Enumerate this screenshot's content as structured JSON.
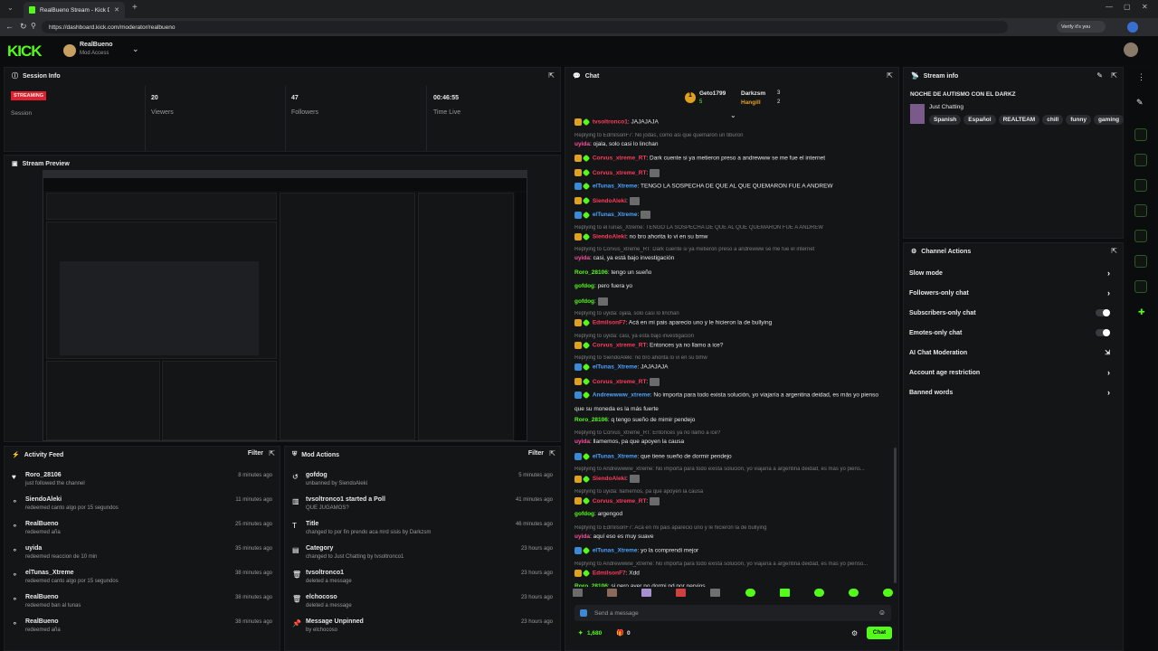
{
  "browser": {
    "tab_title": "RealBueno Stream - Kick Dashbo...",
    "url": "https://dashboard.kick.com/moderator/realbueno",
    "verify_label": "Verify it's you"
  },
  "header": {
    "logo": "KICK",
    "channel_name": "RealBueno",
    "channel_role": "Mod Access"
  },
  "session": {
    "title": "Session Info",
    "status": "STREAMING",
    "status_label": "Session",
    "viewers": "20",
    "viewers_label": "Viewers",
    "followers": "47",
    "followers_label": "Followers",
    "time": "00:46:55",
    "time_label": "Time Live"
  },
  "preview": {
    "title": "Stream Preview"
  },
  "activity": {
    "title": "Activity Feed",
    "filter": "Filter",
    "items": [
      {
        "name": "Roro_28106",
        "sub": "just followed the channel",
        "time": "8 minutes ago",
        "icon": "heart-icon"
      },
      {
        "name": "SiendoAleki",
        "sub": "redeemed canto algo por 15 segundos",
        "time": "11 minutes ago",
        "icon": "redeem-icon"
      },
      {
        "name": "RealBueno",
        "sub": "redeemed aña",
        "time": "25 minutes ago",
        "icon": "redeem-icon"
      },
      {
        "name": "uyida",
        "sub": "redeemed reaccion de 10 min",
        "time": "35 minutes ago",
        "icon": "redeem-icon"
      },
      {
        "name": "elTunas_Xtreme",
        "sub": "redeemed canto algo por 15 segundos",
        "time": "38 minutes ago",
        "icon": "redeem-icon"
      },
      {
        "name": "RealBueno",
        "sub": "redeemed ban al tunas",
        "time": "38 minutes ago",
        "icon": "redeem-icon"
      },
      {
        "name": "RealBueno",
        "sub": "redeemed aña",
        "time": "38 minutes ago",
        "icon": "redeem-icon"
      }
    ]
  },
  "modactions": {
    "title": "Mod Actions",
    "filter": "Filter",
    "items": [
      {
        "name": "gofdog",
        "sub": "unbanned by SiendoAleki",
        "time": "5 minutes ago",
        "icon": "undo-icon"
      },
      {
        "name": "tvsoltronco1 started a Poll",
        "sub": "QUE JUGAMOS?",
        "time": "41 minutes ago",
        "icon": "poll-icon"
      },
      {
        "name": "Title",
        "sub": "changed to por fin prendo aca mrd sisis by Darkzsm",
        "time": "46 minutes ago",
        "icon": "title-icon"
      },
      {
        "name": "Category",
        "sub": "changed to Just Chatting by tvsoltronco1",
        "time": "23 hours ago",
        "icon": "category-icon"
      },
      {
        "name": "tvsoltronco1",
        "sub": "deleted a message",
        "time": "23 hours ago",
        "icon": "trash-icon"
      },
      {
        "name": "elchocoso",
        "sub": "deleted a message",
        "time": "23 hours ago",
        "icon": "trash-icon"
      },
      {
        "name": "Message Unpinned",
        "sub": "by elchocoso",
        "time": "23 hours ago",
        "icon": "unpin-icon"
      }
    ]
  },
  "chat": {
    "title": "Chat",
    "top_gifters": [
      {
        "name": "Geto1799",
        "count": "5"
      },
      {
        "name": "Darkzsm",
        "count": "3"
      },
      {
        "name": "Hangill",
        "count": "2"
      }
    ],
    "messages": [
      {
        "reply": "",
        "user": "tvsoltronco1",
        "color": "red",
        "text": "JAJAJAJA"
      },
      {
        "reply": "Replying to EdmilsonF7: No jodas, como asi que quemaron un tiburon",
        "user": "uyida",
        "color": "pink",
        "text": "ojala, solo casi lo linchan"
      },
      {
        "reply": "",
        "user": "Corvus_xtreme_RT",
        "color": "red",
        "text": "Dark cuente si ya metieron preso a andrewww se me fue el internet"
      },
      {
        "reply": "",
        "user": "Corvus_xtreme_RT",
        "color": "red",
        "text": ""
      },
      {
        "reply": "",
        "user": "elTunas_Xtreme",
        "color": "blue",
        "text": "TENGO LA SOSPECHA DE QUE AL QUE QUEMARON FUE A ANDREW"
      },
      {
        "reply": "",
        "user": "SiendoAleki",
        "color": "red",
        "text": ""
      },
      {
        "reply": "",
        "user": "elTunas_Xtreme",
        "color": "blue",
        "text": ""
      },
      {
        "reply": "Replying to elTunas_Xtreme: TENGO LA SOSPECHA DE QUE AL QUE QUEMARON FUE A ANDREW",
        "user": "SiendoAleki",
        "color": "red",
        "text": "no bro ahorita lo vi en su bmw"
      },
      {
        "reply": "Replying to Corvus_xtreme_RT: Dark cuente si ya metieron preso a andrewww se me fue el internet",
        "user": "uyida",
        "color": "pink",
        "text": "casi, ya está bajo investigación"
      },
      {
        "reply": "",
        "user": "Roro_28106",
        "color": "green",
        "text": "tengo un sueño"
      },
      {
        "reply": "",
        "user": "gofdog",
        "color": "green",
        "text": "pero fuera yo"
      },
      {
        "reply": "",
        "user": "gofdog",
        "color": "green",
        "text": ""
      },
      {
        "reply": "Replying to uyida: ojalá, solo casi lo linchan",
        "user": "EdmilsonF7",
        "color": "red",
        "text": "Acá en mi pais aparecio uno y le hicieron la de bullying"
      },
      {
        "reply": "Replying to uyida: casi, ya está bajo investigación",
        "user": "Corvus_xtreme_RT",
        "color": "red",
        "text": "Entonces ya no llamo a ice?"
      },
      {
        "reply": "Replying to SiendoAleki: no bro ahorita lo vi en su bmw",
        "user": "elTunas_Xtreme",
        "color": "blue",
        "text": "JAJAJAJA"
      },
      {
        "reply": "",
        "user": "Corvus_xtreme_RT",
        "color": "red",
        "text": ""
      },
      {
        "reply": "",
        "user": "Andrewwww_xtreme",
        "color": "blue",
        "text": "No importa para todo exista solución, yo viajaría a argentina deidad, es más yo pienso"
      },
      {
        "reply": "",
        "user": "",
        "color": "",
        "text": "que su moneda es la más fuerte"
      },
      {
        "reply": "",
        "user": "Roro_28106",
        "color": "green",
        "text": "q tengo sueño de mimir pendejo"
      },
      {
        "reply": "Replying to Corvus_xtreme_RT: Entonces ya no llamo a ice?",
        "user": "uyida",
        "color": "pink",
        "text": "llamemos, pa que apoyen la causa"
      },
      {
        "reply": "",
        "user": "elTunas_Xtreme",
        "color": "blue",
        "text": "que tiene sueño de dormir pendejo"
      },
      {
        "reply": "Replying to Andrewwww_xtreme: No importa para todo exista solución, yo viajaría a argentina deidad, es más yo piens...",
        "user": "SiendoAleki",
        "color": "red",
        "text": ""
      },
      {
        "reply": "Replying to uyida: llamemos, pa que apoyen la causa",
        "user": "Corvus_xtreme_RT",
        "color": "red",
        "text": ""
      },
      {
        "reply": "",
        "user": "gofdog",
        "color": "green",
        "text": "argengod"
      },
      {
        "reply": "Replying to EdmilsonF7: Acá en mi pais aparecio uno y le hicieron la de bullying",
        "user": "uyida",
        "color": "pink",
        "text": "aquí eso es muy suave"
      },
      {
        "reply": "",
        "user": "elTunas_Xtreme",
        "color": "blue",
        "text": "yo la comprendi mejor"
      },
      {
        "reply": "Replying to Andrewwww_xtreme: No importa para todo exista solución, yo viajaría a argentina deidad, es más yo pienso...",
        "user": "EdmilsonF7",
        "color": "red",
        "text": "Xdd"
      },
      {
        "reply": "",
        "user": "Roro_28106",
        "color": "green",
        "text": "si pero ayer no dormi nd por nervios"
      }
    ],
    "input_placeholder": "Send a message",
    "points": "1,680",
    "gifts": "0",
    "send_label": "Chat"
  },
  "stream_info": {
    "title": "Stream info",
    "stream_title": "NOCHE DE AUTISMO CON EL DARKZ",
    "category": "Just Chatting",
    "tags": [
      "Spanish",
      "Español",
      "REALTEAM",
      "chill",
      "funny",
      "gaming"
    ]
  },
  "channel_actions": {
    "title": "Channel Actions",
    "items": [
      {
        "label": "Slow mode",
        "control": "arrow"
      },
      {
        "label": "Followers-only chat",
        "control": "arrow"
      },
      {
        "label": "Subscribers-only chat",
        "control": "toggle"
      },
      {
        "label": "Emotes-only chat",
        "control": "toggle"
      },
      {
        "label": "AI Chat Moderation",
        "control": "external"
      },
      {
        "label": "Account age restriction",
        "control": "arrow"
      },
      {
        "label": "Banned words",
        "control": "arrow"
      }
    ]
  },
  "colors": {
    "accent": "#53fc18",
    "streaming_badge": "#e0202e",
    "background": "#0c0d0e",
    "panel": "#141517"
  }
}
